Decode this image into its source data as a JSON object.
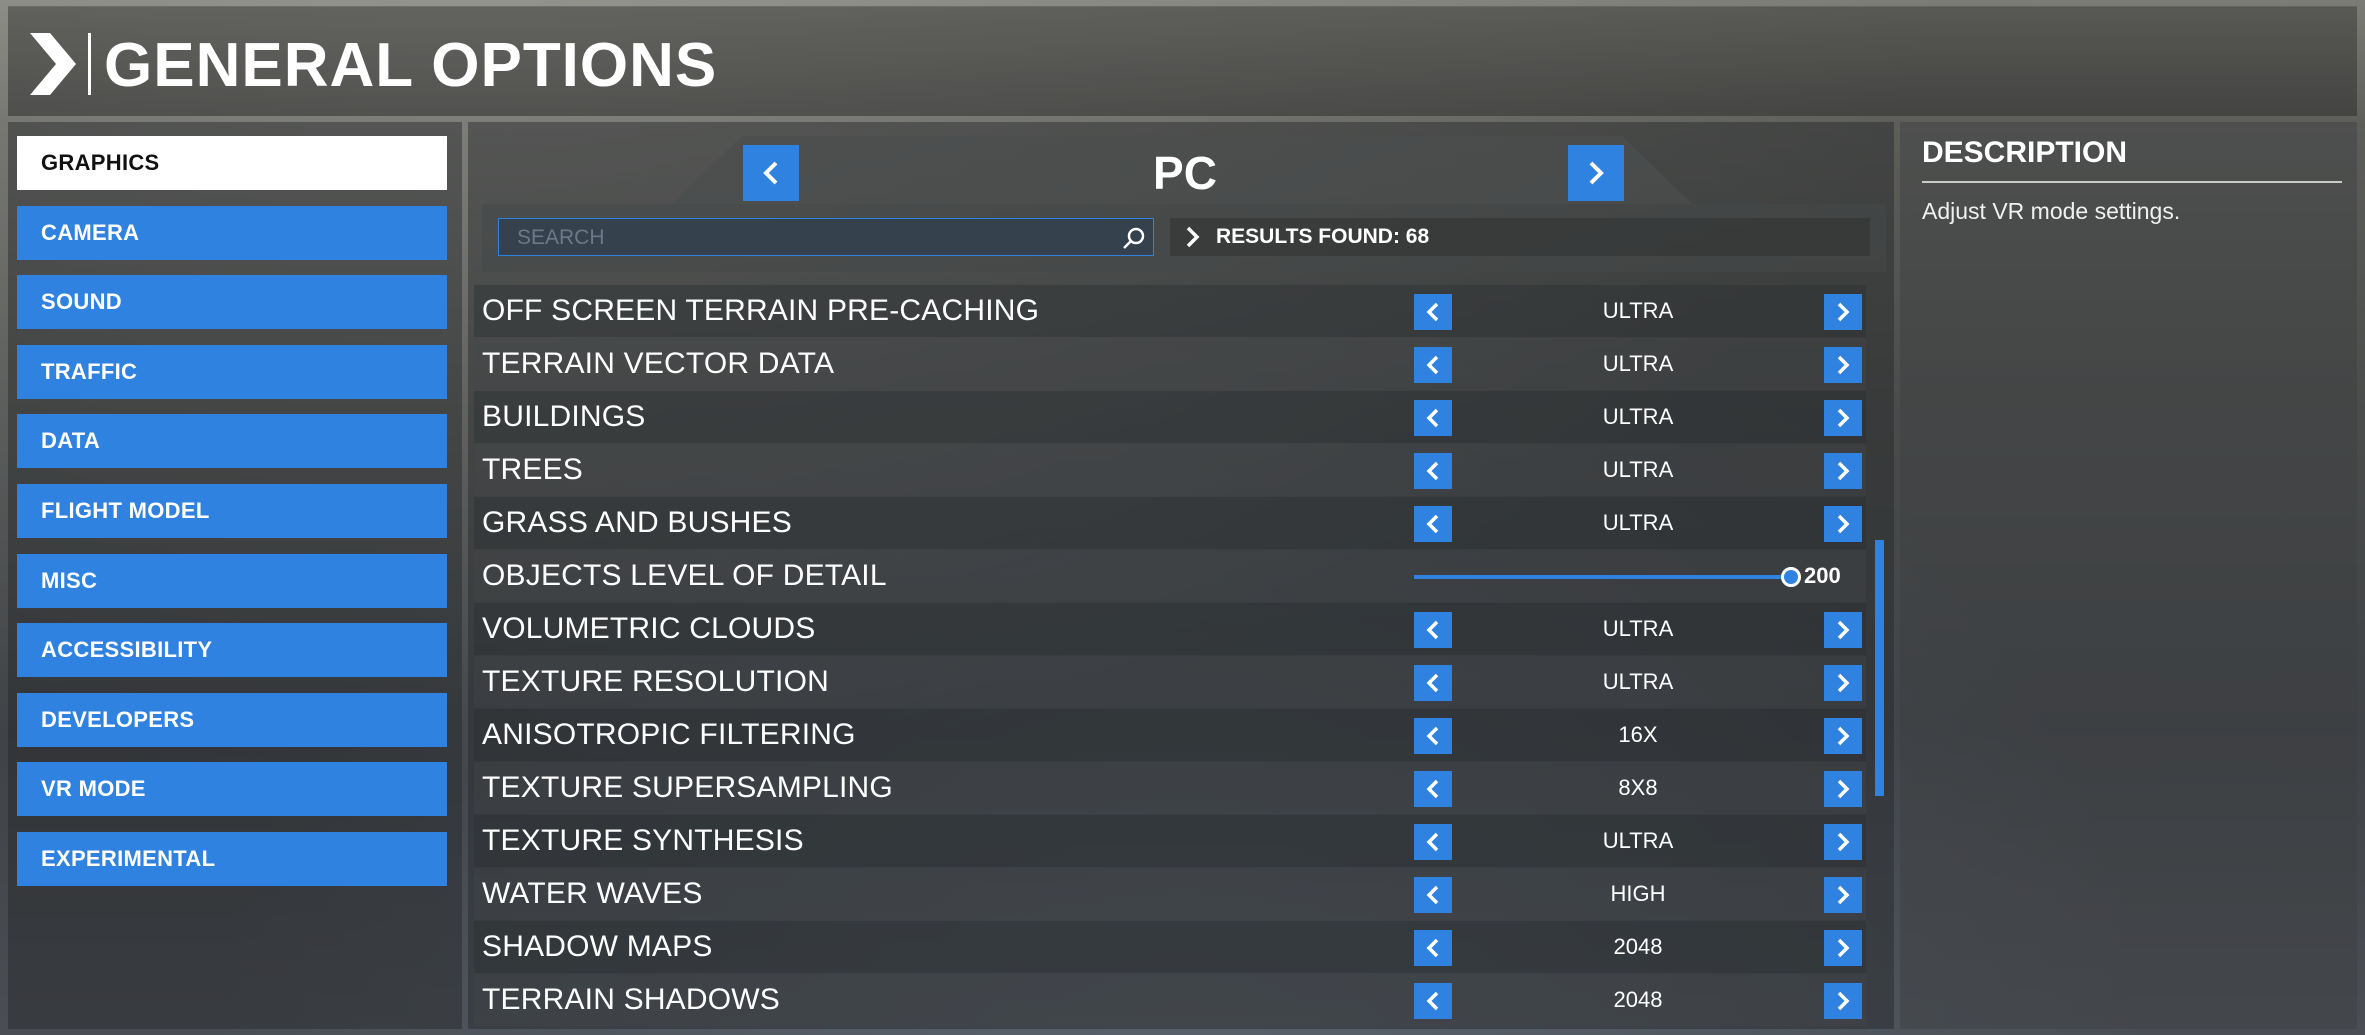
{
  "header": {
    "title": "GENERAL OPTIONS"
  },
  "sidebar": {
    "items": [
      {
        "label": "GRAPHICS",
        "active": true
      },
      {
        "label": "CAMERA"
      },
      {
        "label": "SOUND"
      },
      {
        "label": "TRAFFIC"
      },
      {
        "label": "DATA"
      },
      {
        "label": "FLIGHT MODEL"
      },
      {
        "label": "MISC"
      },
      {
        "label": "ACCESSIBILITY"
      },
      {
        "label": "DEVELOPERS"
      },
      {
        "label": "VR MODE"
      },
      {
        "label": "EXPERIMENTAL"
      }
    ]
  },
  "profile": {
    "title": "PC",
    "prev_icon": "chevron-left-icon",
    "next_icon": "chevron-right-icon"
  },
  "search": {
    "placeholder": "SEARCH",
    "value": "",
    "icon": "search-icon"
  },
  "results": {
    "text": "RESULTS FOUND: 68"
  },
  "settings": [
    {
      "label": "OFF SCREEN TERRAIN PRE-CACHING",
      "value": "ULTRA"
    },
    {
      "label": "TERRAIN VECTOR DATA",
      "value": "ULTRA"
    },
    {
      "label": "BUILDINGS",
      "value": "ULTRA"
    },
    {
      "label": "TREES",
      "value": "ULTRA"
    },
    {
      "label": "GRASS AND BUSHES",
      "value": "ULTRA"
    },
    {
      "label": "OBJECTS LEVEL OF DETAIL",
      "type": "slider",
      "value": "200",
      "fraction": 1.0
    },
    {
      "label": "VOLUMETRIC CLOUDS",
      "value": "ULTRA"
    },
    {
      "label": "TEXTURE RESOLUTION",
      "value": "ULTRA"
    },
    {
      "label": "ANISOTROPIC FILTERING",
      "value": "16X"
    },
    {
      "label": "TEXTURE SUPERSAMPLING",
      "value": "8X8"
    },
    {
      "label": "TEXTURE SYNTHESIS",
      "value": "ULTRA"
    },
    {
      "label": "WATER WAVES",
      "value": "HIGH"
    },
    {
      "label": "SHADOW MAPS",
      "value": "2048"
    },
    {
      "label": "TERRAIN SHADOWS",
      "value": "2048"
    }
  ],
  "description": {
    "title": "DESCRIPTION",
    "text": "Adjust VR mode settings."
  },
  "colors": {
    "accent": "#2f82e0",
    "active_bg": "#ffffff",
    "text": "#ffffff"
  }
}
